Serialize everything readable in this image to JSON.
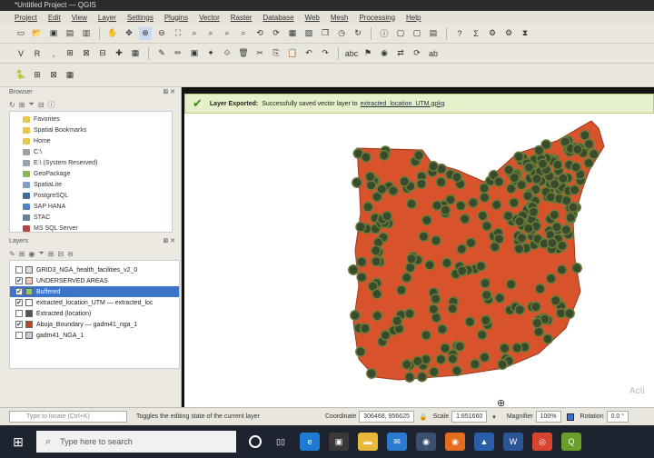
{
  "window": {
    "title": "*Untitled Project — QGIS"
  },
  "menu": [
    "Project",
    "Edit",
    "View",
    "Layer",
    "Settings",
    "Plugins",
    "Vector",
    "Raster",
    "Database",
    "Web",
    "Mesh",
    "Processing",
    "Help"
  ],
  "browser": {
    "title": "Browser",
    "items": [
      {
        "label": "Favorites",
        "color": "#e9c64a"
      },
      {
        "label": "Spatial Bookmarks",
        "color": "#e9c64a"
      },
      {
        "label": "Home",
        "color": "#e9c64a"
      },
      {
        "label": "C:\\",
        "color": "#9aa3ad"
      },
      {
        "label": "E:\\ (System Reserved)",
        "color": "#9aa3ad"
      },
      {
        "label": "GeoPackage",
        "color": "#8fb55b"
      },
      {
        "label": "SpatiaLite",
        "color": "#7da0c8"
      },
      {
        "label": "PostgreSQL",
        "color": "#3f6e9b"
      },
      {
        "label": "SAP HANA",
        "color": "#4a86c5"
      },
      {
        "label": "STAC",
        "color": "#6a7fa0"
      },
      {
        "label": "MS SQL Server",
        "color": "#b04a4a"
      }
    ]
  },
  "layers": {
    "title": "Layers",
    "items": [
      {
        "label": "GRID3_NGA_health_facilities_v2_0",
        "checked": false,
        "swatch": "#dddddd",
        "selected": false
      },
      {
        "label": "UNDERSERVED AREAS",
        "checked": true,
        "swatch": "#f0c9b8",
        "selected": false
      },
      {
        "label": "Buffered",
        "checked": true,
        "swatch": "#9ec36d",
        "selected": true
      },
      {
        "label": "extracted_location_UTM — extracted_loc",
        "checked": true,
        "swatch": "#ffffff",
        "selected": false
      },
      {
        "label": "Extracted (location)",
        "checked": false,
        "swatch": "#555555",
        "selected": false
      },
      {
        "label": "Abuja_Boundary — gadm41_nga_1",
        "checked": true,
        "swatch": "#b84a2a",
        "selected": false
      },
      {
        "label": "gadm41_NGA_1",
        "checked": false,
        "swatch": "#c9c9e0",
        "selected": false
      }
    ]
  },
  "message": {
    "title": "Layer Exported:",
    "text": "Successfully saved vector layer to",
    "file": "extracted_location_UTM.gpkg"
  },
  "status": {
    "locate_placeholder": "Type to locate (Ctrl+K)",
    "hint": "Toggles the editing state of the current layer",
    "coordinate_label": "Coordinate",
    "coordinate": "306468, 956625",
    "scale_label": "Scale",
    "scale": "1:851660",
    "magnifier_label": "Magnifier",
    "magnifier": "100%",
    "rotation_label": "Rotation",
    "rotation": "0.0 °"
  },
  "taskbar": {
    "search_placeholder": "Type here to search"
  },
  "map": {
    "boundary_color": "#d8532b",
    "point_fill": "#3a4a2c",
    "point_ring": "#6a7c3a",
    "canvas_bg": "#ffffff"
  },
  "canvas_text": {
    "watermark": "Acti"
  }
}
